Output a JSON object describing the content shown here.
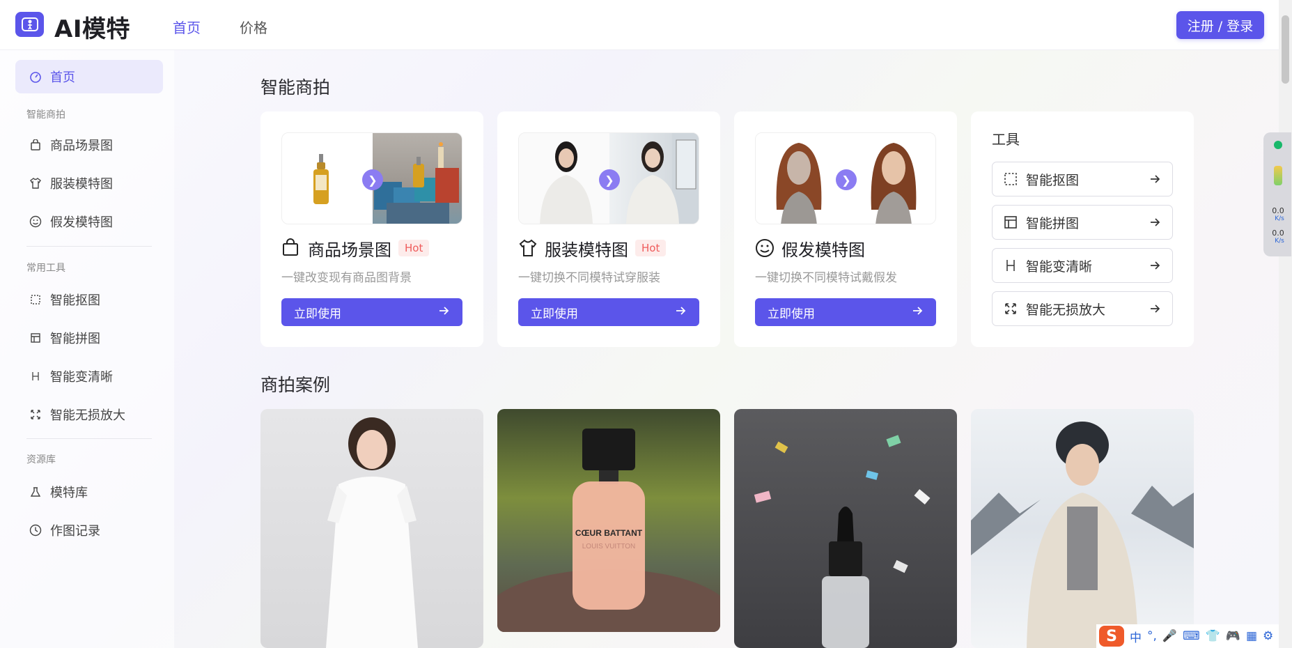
{
  "header": {
    "app_name": "AI模特",
    "nav": [
      {
        "label": "首页",
        "active": true
      },
      {
        "label": "价格",
        "active": false
      }
    ],
    "login_label": "注册 / 登录"
  },
  "sidebar": {
    "home": "首页",
    "groups": [
      {
        "title": "智能商拍",
        "items": [
          "商品场景图",
          "服装模特图",
          "假发模特图"
        ]
      },
      {
        "title": "常用工具",
        "items": [
          "智能抠图",
          "智能拼图",
          "智能变清晰",
          "智能无损放大"
        ]
      },
      {
        "title": "资源库",
        "items": [
          "模特库",
          "作图记录"
        ]
      }
    ]
  },
  "main": {
    "section1_title": "智能商拍",
    "cards": [
      {
        "title": "商品场景图",
        "badge": "Hot",
        "desc": "一键改变现有商品图背景",
        "button": "立即使用"
      },
      {
        "title": "服装模特图",
        "badge": "Hot",
        "desc": "一键切换不同模特试穿服装",
        "button": "立即使用"
      },
      {
        "title": "假发模特图",
        "desc": "一键切换不同模特试戴假发",
        "button": "立即使用"
      }
    ],
    "tools": {
      "title": "工具",
      "items": [
        "智能抠图",
        "智能拼图",
        "智能变清晰",
        "智能无损放大"
      ]
    },
    "section2_title": "商拍案例",
    "case_texts": {
      "perfume_label_1": "CŒUR BATTANT",
      "perfume_label_2": "LOUIS VUITTON"
    }
  },
  "net_widget": {
    "up": "0.0",
    "up_unit": "K/s",
    "down": "0.0",
    "down_unit": "K/s"
  },
  "ime": {
    "lang": "中"
  },
  "colors": {
    "accent": "#5b55ea",
    "hot": "#ef5b5b"
  }
}
